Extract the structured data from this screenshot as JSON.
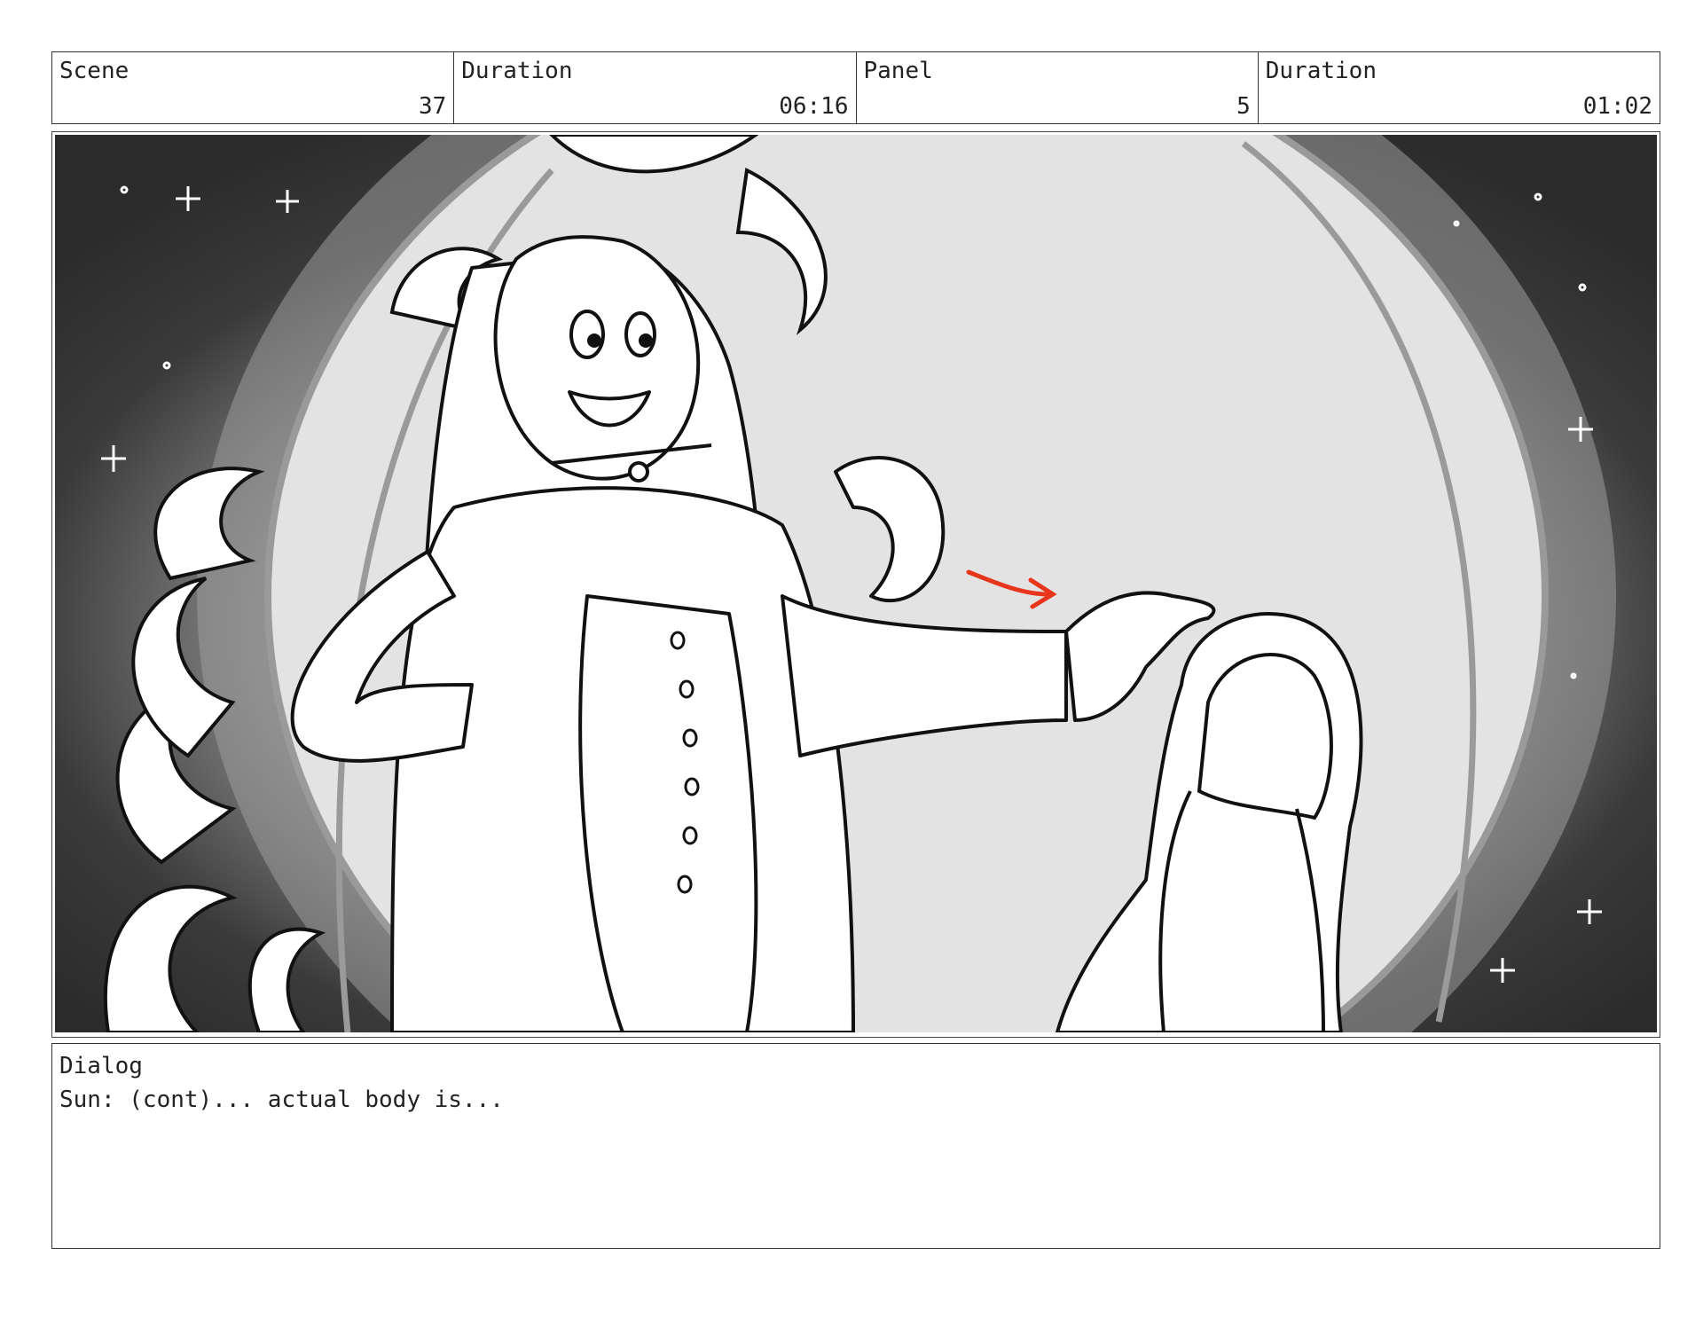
{
  "header": {
    "scene_label": "Scene",
    "scene_value": "37",
    "scene_duration_label": "Duration",
    "scene_duration_value": "06:16",
    "panel_label": "Panel",
    "panel_value": "5",
    "panel_duration_label": "Duration",
    "panel_duration_value": "01:02"
  },
  "panel": {
    "content": "storyboard sketch: tall sun character with flowing hair gesturing toward a small figure, large moon disc behind, starry night sky",
    "arrow_color": "#e8361c"
  },
  "dialog": {
    "label": "Dialog",
    "text": "Sun: (cont)... actual body is..."
  }
}
